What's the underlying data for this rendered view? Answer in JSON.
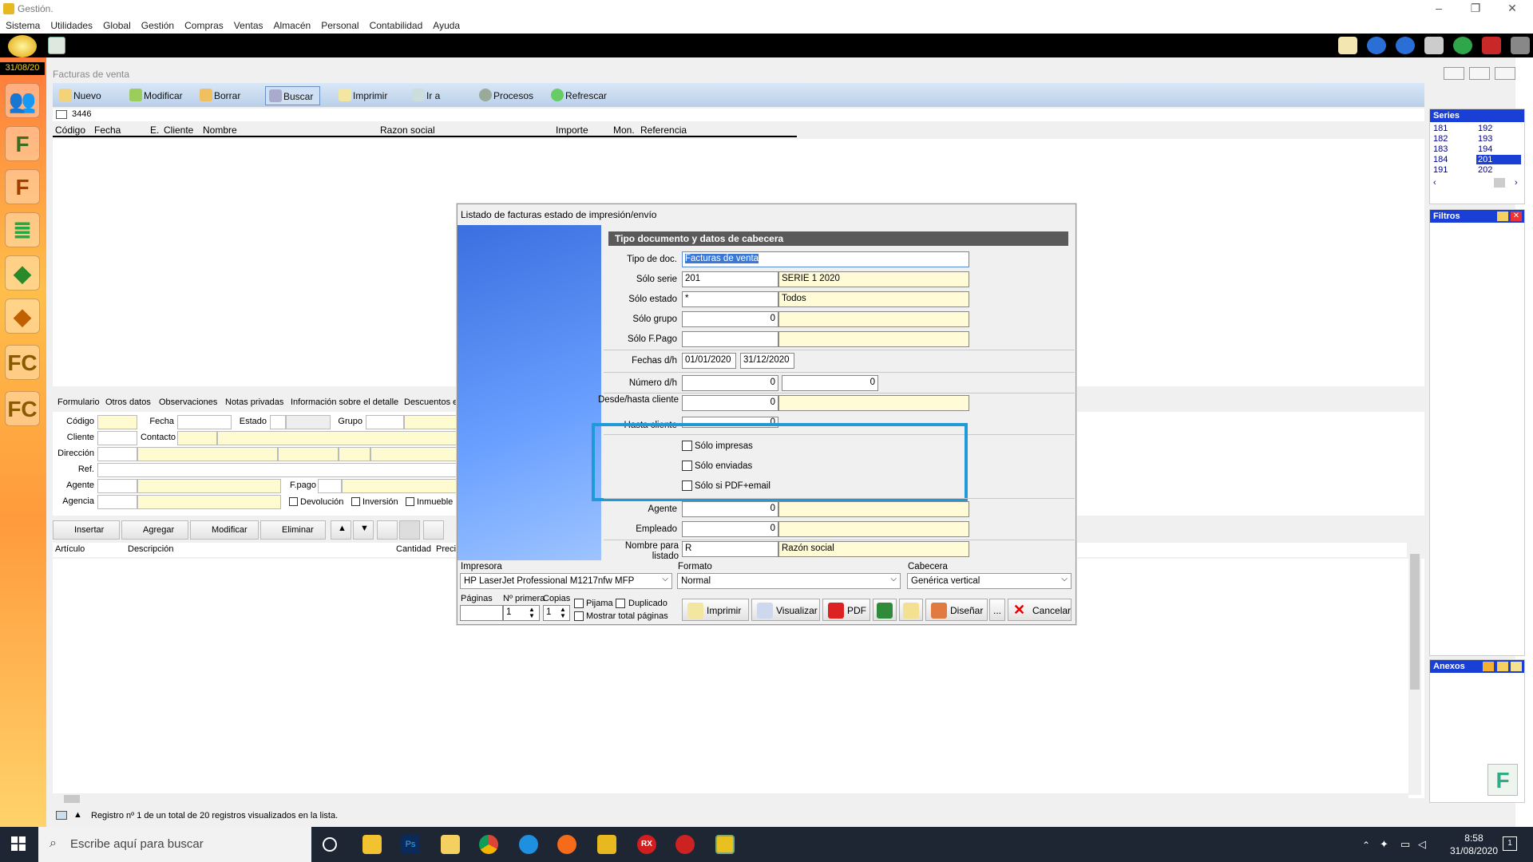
{
  "window": {
    "title": "Gestión."
  },
  "menu": [
    "Sistema",
    "Utilidades",
    "Global",
    "Gestión",
    "Compras",
    "Ventas",
    "Almacén",
    "Personal",
    "Contabilidad",
    "Ayuda"
  ],
  "date_badge": "31/08/20",
  "invoices": {
    "title": "Facturas de venta",
    "buttons": [
      "Nuevo",
      "Modificar",
      "Borrar",
      "Buscar",
      "Imprimir",
      "Ir a",
      "Procesos",
      "Refrescar"
    ],
    "record_value": "3446",
    "columns": [
      "Código",
      "Fecha",
      "E.",
      "Cliente",
      "Nombre",
      "Razon social",
      "Importe",
      "Mon.",
      "Referencia"
    ]
  },
  "series_panel": {
    "title": "Series",
    "values": [
      "181",
      "192",
      "182",
      "193",
      "183",
      "194",
      "184",
      "201",
      "191",
      "202"
    ],
    "selected": "201"
  },
  "filtros_panel": {
    "title": "Filtros"
  },
  "anexos_panel": {
    "title": "Anexos"
  },
  "form_tabs": [
    "Formulario",
    "Otros datos",
    "Observaciones",
    "Notas privadas",
    "Información sobre el detalle",
    "Descuentos e"
  ],
  "form": {
    "codigo": "Código",
    "fecha": "Fecha",
    "estado": "Estado",
    "grupo": "Grupo",
    "cliente": "Cliente",
    "contacto": "Contacto",
    "direccion": "Dirección",
    "ref": "Ref.",
    "agente": "Agente",
    "fpago": "F.pago",
    "agencia": "Agencia",
    "devolucion": "Devolución",
    "inversion": "Inversión",
    "inmueble": "Inmueble"
  },
  "detail_buttons": [
    "Insertar",
    "Agregar",
    "Modificar",
    "Eliminar"
  ],
  "detail_columns": [
    "Artículo",
    "Descripción",
    "Cantidad",
    "Preci"
  ],
  "status_text": "Registro nº 1 de un total de 20 registros visualizados en la lista.",
  "dialog": {
    "title": "Listado de facturas estado de impresión/envío",
    "section": "Tipo documento y datos de cabecera",
    "labels": {
      "tipo_doc": "Tipo de doc.",
      "solo_serie": "Sólo serie",
      "solo_estado": "Sólo estado",
      "solo_grupo": "Sólo grupo",
      "solo_fpago": "Sólo F.Pago",
      "fechas": "Fechas d/h",
      "numero": "Número d/h",
      "desde_cliente": "Desde/hasta cliente",
      "hasta_cliente": "Hasta cliente",
      "agente": "Agente",
      "empleado": "Empleado",
      "nombre_listado": "Nombre para listado"
    },
    "values": {
      "tipo_doc": "Facturas de venta",
      "serie": "201",
      "serie_name": "SERIE 1 2020",
      "estado": "*",
      "estado_name": "Todos",
      "grupo": "0",
      "fecha_desde": "01/01/2020",
      "fecha_hasta": "31/12/2020",
      "numero_desde": "0",
      "numero_hasta": "0",
      "cliente_desde": "0",
      "cliente_hasta": "0",
      "agente": "0",
      "empleado": "0",
      "nombre": "R",
      "nombre_desc": "Razón social"
    },
    "checks": [
      "Sólo impresas",
      "Sólo enviadas",
      "Sólo si PDF+email"
    ],
    "impresora_label": "Impresora",
    "impresora": "HP LaserJet Professional M1217nfw MFP",
    "formato_label": "Formato",
    "formato": "Normal",
    "cabecera_label": "Cabecera",
    "cabecera": "Genérica vertical",
    "paginas_label": "Páginas",
    "primera_label": "Nº primera",
    "copias_label": "Copias",
    "primera": "1",
    "copias": "1",
    "pijama": "Pijama",
    "duplicado": "Duplicado",
    "mostrar_total": "Mostrar total páginas",
    "buttons": {
      "imprimir": "Imprimir",
      "visualizar": "Visualizar",
      "pdf": "PDF",
      "disenar": "Diseñar",
      "mas": "...",
      "cancelar": "Cancelar"
    }
  },
  "taskbar": {
    "search_placeholder": "Escribe aquí para buscar",
    "time": "8:58",
    "date": "31/08/2020",
    "notif": "1"
  },
  "colors": {
    "accent": "#1e9ad8",
    "series_header": "#1a3fd6",
    "yellow_field": "#fffbd6"
  }
}
